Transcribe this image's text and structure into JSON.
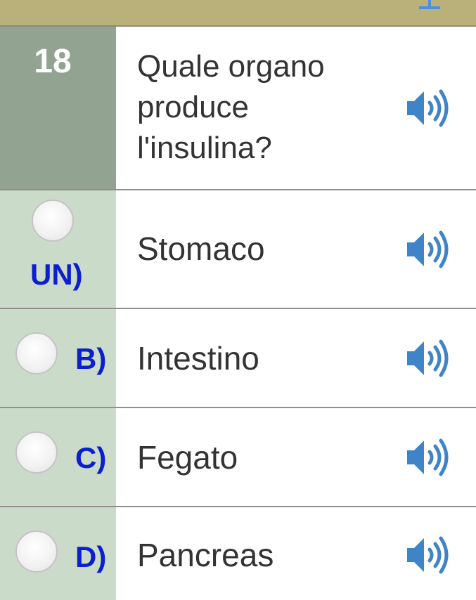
{
  "question": {
    "number": "18",
    "text": "Quale organo produce l'insulina?"
  },
  "answers": [
    {
      "letter": "UN)",
      "text": "Stomaco"
    },
    {
      "letter": "B)",
      "text": "Intestino"
    },
    {
      "letter": "C)",
      "text": "Fegato"
    },
    {
      "letter": "D)",
      "text": "Pancreas"
    }
  ],
  "colors": {
    "top_bar": "#b9b07a",
    "question_number_bg": "#93a392",
    "answer_option_bg": "#cbdbc9",
    "letter": "#0b1fd1",
    "speaker": "#3f84c7"
  },
  "icons": {
    "speaker": "speaker-icon",
    "radio": "radio-button"
  }
}
